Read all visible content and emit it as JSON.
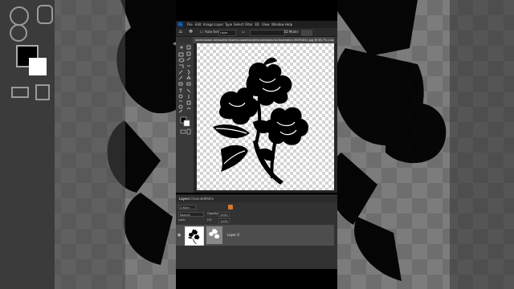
{
  "app": {
    "menu": [
      "File",
      "Edit",
      "Image",
      "Layer",
      "Type",
      "Select",
      "Filter",
      "3D",
      "View",
      "Window",
      "Help"
    ],
    "logo": "Ps"
  },
  "options_bar": {
    "auto_select_label": "Auto-Select:",
    "auto_select_value": "Layer",
    "mode_label": "3D Mode:"
  },
  "document_tab": {
    "title": "vector-black-silhouette-flowers-isolated-white-background-illustration-96391841.jpg @ 66.7% (Lay..."
  },
  "panels": {
    "tabs": [
      "Layers",
      "Channels",
      "Paths"
    ],
    "filter_label": "Q Kind",
    "blend_mode": "Normal",
    "opacity_label": "Opacity:",
    "opacity_value": "100%",
    "lock_label": "Lock:",
    "fill_label": "Fill:",
    "fill_value": "100%",
    "layer_name": "Layer 0"
  },
  "colors": {
    "accent": "#0f3a6e",
    "ps_blue": "#5ab0ff",
    "flower": "#000000"
  },
  "icons": [
    "move-icon",
    "marquee-icon",
    "lasso-icon",
    "crop-icon",
    "eyedropper-icon",
    "brush-icon",
    "eraser-icon",
    "text-icon",
    "hand-icon",
    "zoom-icon",
    "eye-icon"
  ]
}
